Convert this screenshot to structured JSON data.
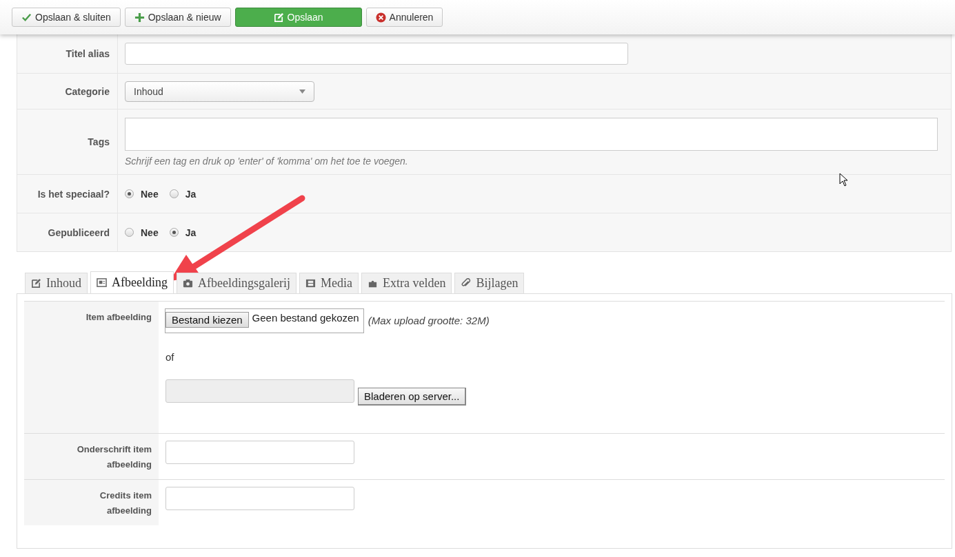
{
  "toolbar": [
    {
      "label": "Opslaan & sluiten",
      "kind": "check"
    },
    {
      "label": "Opslaan & nieuw",
      "kind": "plus"
    },
    {
      "label": "Opslaan",
      "kind": "save"
    },
    {
      "label": "Annuleren",
      "kind": "cancel"
    }
  ],
  "form": [
    {
      "kind": "text",
      "label": "Titel alias"
    },
    {
      "kind": "select",
      "label": "Categorie",
      "value": "Inhoud"
    },
    {
      "kind": "tags",
      "label": "Tags",
      "hint": "Schrijf een tag en druk op 'enter' of 'komma' om het toe te voegen."
    },
    {
      "kind": "radio",
      "label": "Is het speciaal?",
      "options": [
        {
          "label": "Nee",
          "selected": true
        },
        {
          "label": "Ja",
          "selected": false
        }
      ]
    },
    {
      "kind": "radio",
      "label": "Gepubliceerd",
      "options": [
        {
          "label": "Nee",
          "selected": false
        },
        {
          "label": "Ja",
          "selected": true
        }
      ]
    }
  ],
  "tabs": [
    {
      "label": "Inhoud",
      "kind": "edit",
      "selected": false
    },
    {
      "label": "Afbeelding",
      "kind": "image",
      "selected": true
    },
    {
      "label": "Afbeeldingsgalerij",
      "kind": "camera",
      "selected": false
    },
    {
      "label": "Media",
      "kind": "film",
      "selected": false
    },
    {
      "label": "Extra velden",
      "kind": "puzzle",
      "selected": false
    },
    {
      "label": "Bijlagen",
      "kind": "paperclip",
      "selected": false
    }
  ],
  "image_form": [
    {
      "kind": "upload",
      "label": "Item afbeelding",
      "button": "Bestand kiezen",
      "file_status": "Geen bestand gekozen",
      "note": "(Max upload grootte: 32M)",
      "separator": "of",
      "browse_button": "Bladeren op server..."
    },
    {
      "kind": "text",
      "label": "Onderschrift item afbeelding"
    },
    {
      "kind": "text",
      "label": "Credits item afbeelding"
    }
  ]
}
